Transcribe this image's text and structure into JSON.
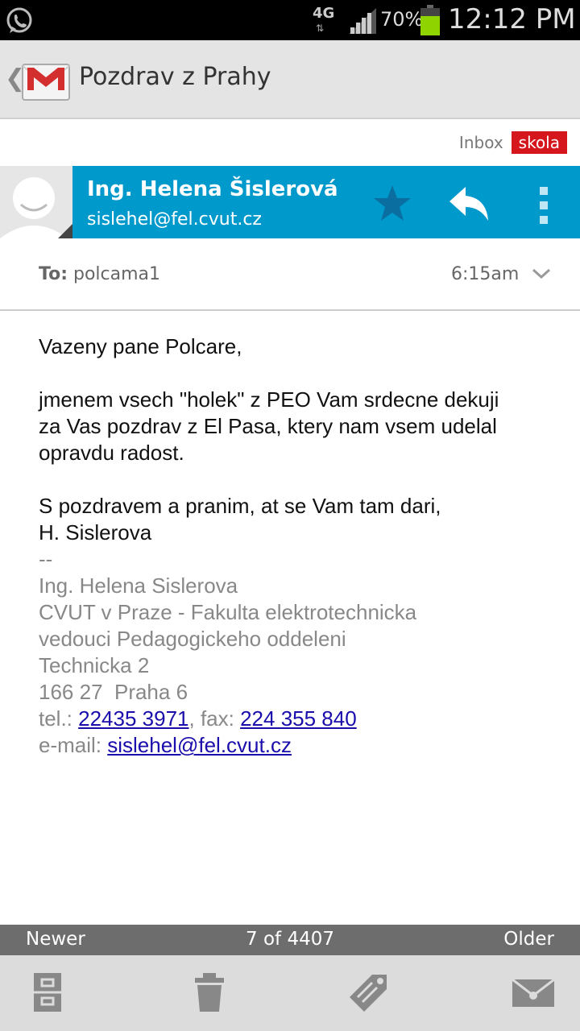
{
  "status_bar": {
    "network": "4G",
    "battery_percent": "70%",
    "time": "12:12 PM"
  },
  "action_bar": {
    "title": "Pozdrav z Prahy"
  },
  "labels": [
    "Inbox",
    "skola"
  ],
  "sender": {
    "name": "Ing. Helena Šislerová",
    "email": "sislehel@fel.cvut.cz"
  },
  "recipient_row": {
    "to_label": "To:",
    "to_value": "polcama1",
    "time": "6:15am"
  },
  "message": {
    "greeting": "Vazeny pane Polcare,",
    "paragraph": [
      "jmenem vsech \"holek\" z PEO Vam srdecne dekuji",
      "za Vas pozdrav z El Pasa, ktery nam vsem udelal",
      "opravdu radost."
    ],
    "closing": [
      "S pozdravem a pranim, at se Vam tam dari,",
      "H. Sislerova"
    ],
    "signature": {
      "separator": "--",
      "lines": [
        "Ing. Helena Sislerova",
        "CVUT v Praze - Fakulta elektrotechnicka",
        "vedouci Pedagogickeho oddeleni",
        "Technicka 2",
        "166 27  Praha 6"
      ],
      "tel_label": "tel.: ",
      "tel": "22435 3971",
      "fax_label": ", fax: ",
      "fax": "224 355 840",
      "email_label": "e-mail: ",
      "email": "sislehel@fel.cvut.cz"
    }
  },
  "pager": {
    "newer": "Newer",
    "count": "7 of 4407",
    "older": "Older"
  },
  "bottom_bar": {
    "icons": [
      "archive-icon",
      "delete-icon",
      "labels-icon",
      "mark-unread-icon"
    ]
  },
  "colors": {
    "sender_bar": "#0099cc",
    "label_skola": "#d5161c",
    "pager": "#6d6d6d",
    "bottom_bar": "#dcdcdc"
  }
}
